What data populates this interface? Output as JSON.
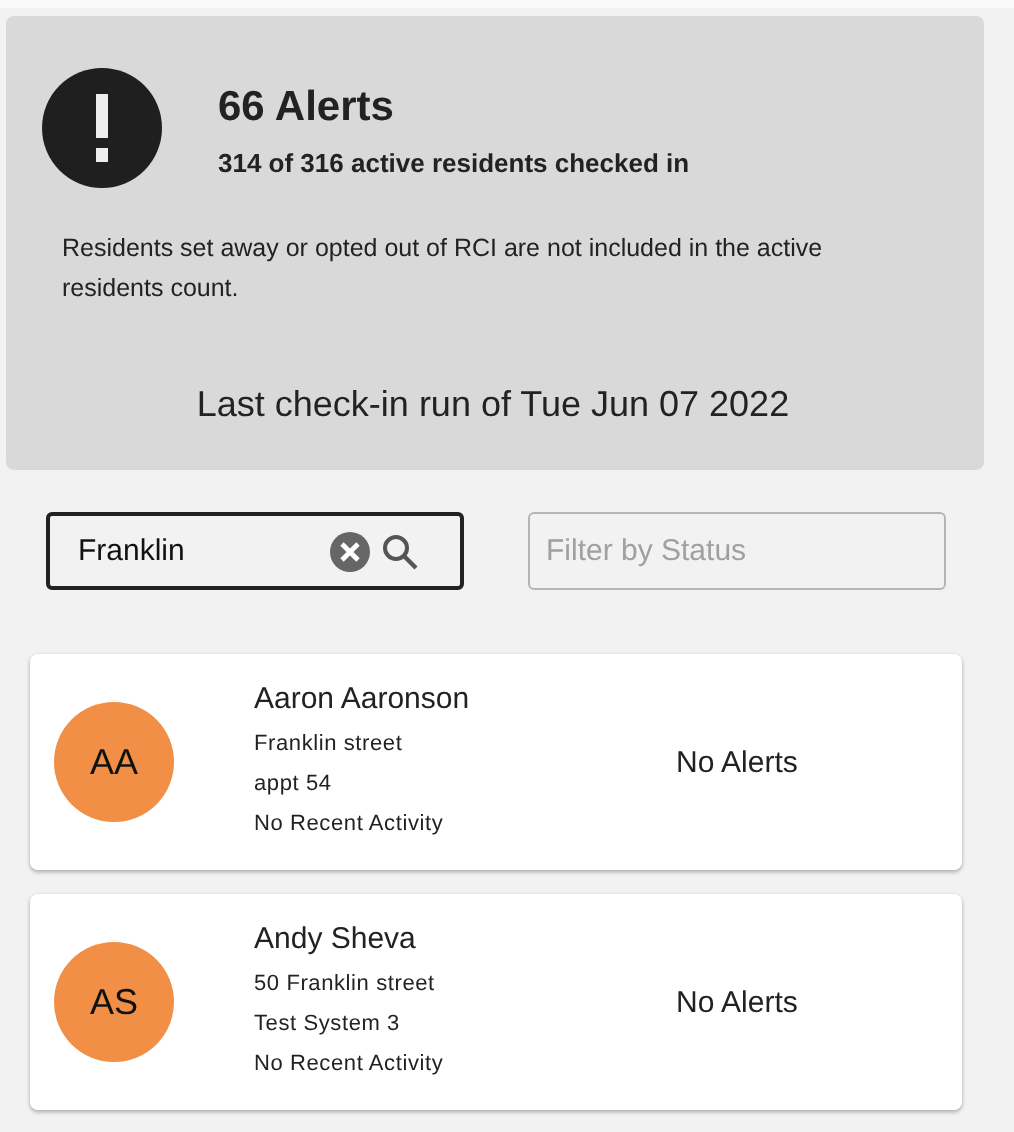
{
  "summary": {
    "title": "66 Alerts",
    "subtitle": "314 of 316 active residents checked in",
    "note": "Residents set away or opted out of RCI are not included in the active residents count.",
    "last_run": "Last check-in run of Tue Jun 07 2022"
  },
  "search": {
    "value": "Franklin"
  },
  "status_filter": {
    "placeholder": "Filter by Status"
  },
  "residents": [
    {
      "initials": "AA",
      "name": "Aaron Aaronson",
      "lines": [
        "Franklin street",
        "appt 54",
        "No Recent Activity"
      ],
      "status": "No Alerts",
      "color": "#f08f45"
    },
    {
      "initials": "AS",
      "name": "Andy Sheva",
      "lines": [
        "50 Franklin street",
        "Test System 3",
        "No Recent Activity"
      ],
      "status": "No Alerts",
      "color": "#f08f45"
    }
  ]
}
